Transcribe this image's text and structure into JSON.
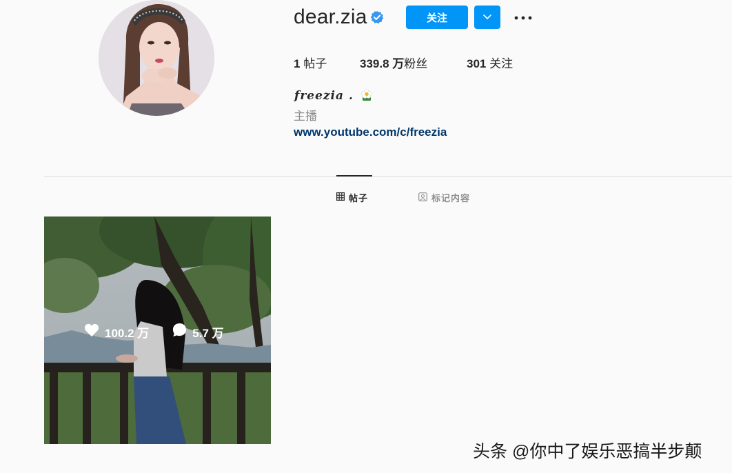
{
  "profile": {
    "username": "dear.zia",
    "verified": true,
    "follow_label": "关注",
    "stats": {
      "posts_count": "1",
      "posts_label": "帖子",
      "followers_count": "339.8 万",
      "followers_label": "粉丝",
      "following_count": "301",
      "following_label": "关注"
    },
    "full_name": "𝒇𝒓𝒆𝒆𝒛𝒊𝒂 .",
    "category": "主播",
    "website": "www.youtube.com/c/freezia"
  },
  "tabs": [
    {
      "label": "帖子",
      "icon": "grid-icon",
      "active": true
    },
    {
      "label": "标记内容",
      "icon": "tagged-icon",
      "active": false
    }
  ],
  "posts": [
    {
      "likes": "100.2 万",
      "comments": "5.7 万"
    }
  ],
  "watermark": "头条 @你中了娱乐恶搞半步颠",
  "colors": {
    "accent": "#0095f6",
    "link": "#00376b",
    "text": "#262626",
    "muted": "#8e8e8e",
    "background": "#fafafa"
  }
}
